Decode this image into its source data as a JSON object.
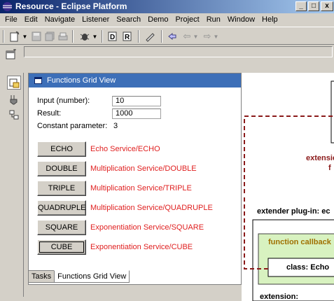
{
  "window": {
    "title": "Resource - Eclipse Platform",
    "controls": [
      "_",
      "□",
      "x"
    ]
  },
  "menu": [
    {
      "label": "File"
    },
    {
      "label": "Edit"
    },
    {
      "label": "Navigate"
    },
    {
      "label": "Listener"
    },
    {
      "label": "Search"
    },
    {
      "label": "Demo"
    },
    {
      "label": "Project"
    },
    {
      "label": "Run"
    },
    {
      "label": "Window"
    },
    {
      "label": "Help"
    }
  ],
  "view": {
    "title": "Functions Grid View",
    "input_label": "Input (number):",
    "input_value": "10",
    "result_label": "Result:",
    "result_value": "1000",
    "constant_label": "Constant parameter:",
    "constant_value": "3",
    "services": [
      {
        "button": "ECHO",
        "label": "Echo Service/ECHO"
      },
      {
        "button": "DOUBLE",
        "label": "Multiplication Service/DOUBLE"
      },
      {
        "button": "TRIPLE",
        "label": "Multiplication Service/TRIPLE"
      },
      {
        "button": "QUADRUPLE",
        "label": "Multiplication Service/QUADRUPLE"
      },
      {
        "button": "SQUARE",
        "label": "Exponentiation Service/SQUARE"
      },
      {
        "button": "CUBE",
        "label": "Exponentiation Service/CUBE"
      }
    ]
  },
  "tabs": [
    {
      "label": "Tasks",
      "active": false
    },
    {
      "label": "Functions Grid View",
      "active": true
    }
  ],
  "diagram": {
    "extension_text_1": "extensio",
    "extension_text_2": "f",
    "extender_label": "extender plug-in: ec",
    "callback_label": "function callback",
    "class_label": "class: Echo",
    "extension_label": "extension:"
  },
  "colors": {
    "accent_red": "#e02020",
    "diagram_dark_red": "#8b1a1a",
    "callback_green_bg": "#d8f2c0",
    "callback_text": "#a07000"
  }
}
